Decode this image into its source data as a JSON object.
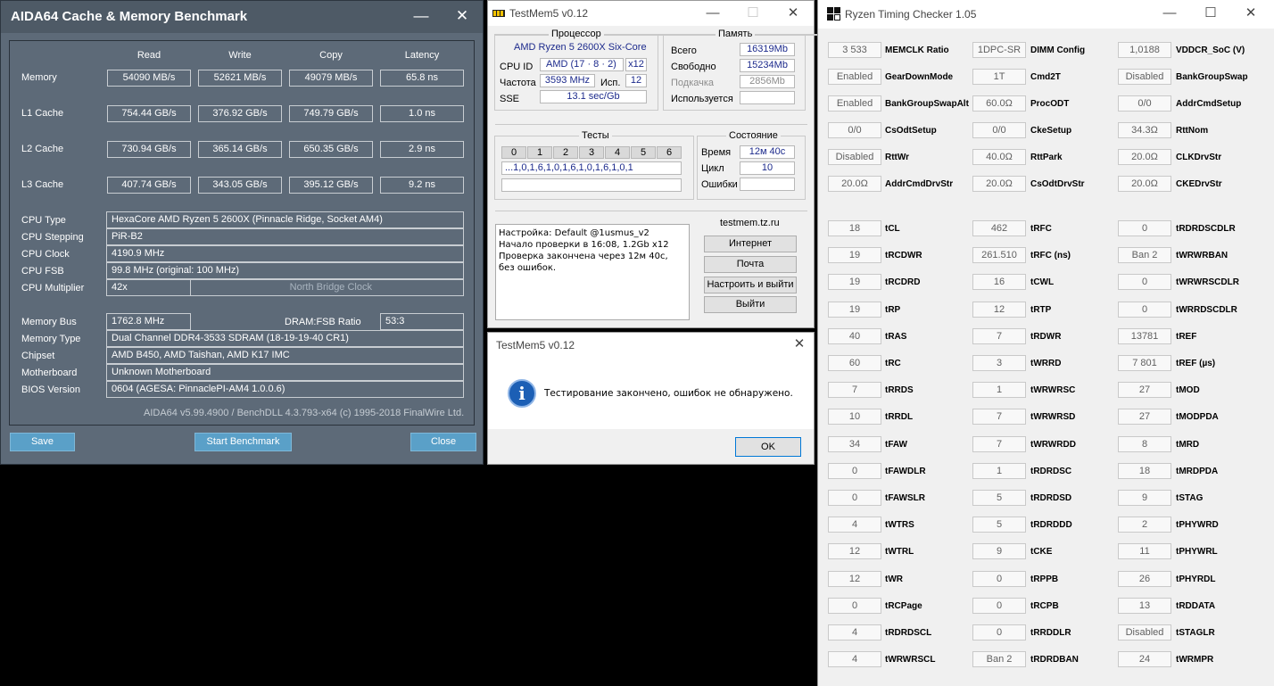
{
  "aida": {
    "title": "AIDA64 Cache & Memory Benchmark",
    "minimize": "—",
    "close_x": "✕",
    "columns": [
      "Read",
      "Write",
      "Copy",
      "Latency"
    ],
    "bench": [
      {
        "label": "Memory",
        "values": [
          "54090 MB/s",
          "52621 MB/s",
          "49079 MB/s",
          "65.8 ns"
        ]
      },
      {
        "label": "L1 Cache",
        "values": [
          "754.44 GB/s",
          "376.92 GB/s",
          "749.79 GB/s",
          "1.0 ns"
        ]
      },
      {
        "label": "L2 Cache",
        "values": [
          "730.94 GB/s",
          "365.14 GB/s",
          "650.35 GB/s",
          "2.9 ns"
        ]
      },
      {
        "label": "L3 Cache",
        "values": [
          "407.74 GB/s",
          "343.05 GB/s",
          "395.12 GB/s",
          "9.2 ns"
        ]
      }
    ],
    "cpu_type_label": "CPU Type",
    "cpu_type": "HexaCore AMD Ryzen 5 2600X  (Pinnacle Ridge, Socket AM4)",
    "cpu_stepping_label": "CPU Stepping",
    "cpu_stepping": "PiR-B2",
    "cpu_clock_label": "CPU Clock",
    "cpu_clock": "4190.9 MHz",
    "cpu_fsb_label": "CPU FSB",
    "cpu_fsb": "99.8 MHz  (original: 100 MHz)",
    "cpu_mult_label": "CPU Multiplier",
    "cpu_mult": "42x",
    "nb_clock_label": "North Bridge Clock",
    "mem_bus_label": "Memory Bus",
    "mem_bus": "1762.8 MHz",
    "dram_fsb_label": "DRAM:FSB Ratio",
    "dram_fsb": "53:3",
    "mem_type_label": "Memory Type",
    "mem_type": "Dual Channel DDR4-3533 SDRAM  (18-19-19-40 CR1)",
    "chipset_label": "Chipset",
    "chipset": "AMD B450, AMD Taishan, AMD K17 IMC",
    "mobo_label": "Motherboard",
    "mobo": "Unknown Motherboard",
    "bios_label": "BIOS Version",
    "bios": "0604  (AGESA: PinnaclePI-AM4 1.0.0.6)",
    "footer": "AIDA64 v5.99.4900 / BenchDLL 4.3.793-x64  (c) 1995-2018 FinalWire Ltd.",
    "btn_save": "Save",
    "btn_start": "Start Benchmark",
    "btn_close": "Close"
  },
  "testmem": {
    "title": "TestMem5 v0.12",
    "minimize": "—",
    "maximize": "☐",
    "close_x": "✕",
    "proc_group": "Процессор",
    "proc_name": "AMD Ryzen 5 2600X Six-Core",
    "cpu_id_label": "CPU ID",
    "cpu_id": "AMD  (17 · 8 · 2)",
    "cpu_threads": "x12",
    "freq_label": "Частота",
    "freq": "3593 MHz",
    "used_label": "Исп.",
    "used": "12",
    "sse_label": "SSE",
    "sse": "13.1 sec/Gb",
    "mem_group": "Память",
    "total_label": "Всего",
    "total": "16319Mb",
    "free_label": "Свободно",
    "free": "15234Mb",
    "swap_label": "Подкачка",
    "swap": "2856Mb",
    "inuse_label": "Используется",
    "tests_group": "Тесты",
    "test_headers": [
      "0",
      "1",
      "2",
      "3",
      "4",
      "5",
      "6"
    ],
    "test_seq": "...1,0,1,6,1,0,1,6,1,0,1,6,1,0,1",
    "state_group": "Состояние",
    "time_label": "Время",
    "time": "12м 40с",
    "cycle_label": "Цикл",
    "cycle": "10",
    "errors_label": "Ошибки",
    "log": "Настройка: Default @1usmus_v2\nНачало проверки в 16:08, 1.2Gb x12\nПроверка закончена через 12м 40с,\nбез ошибок.",
    "site": "testmem.tz.ru",
    "btn_internet": "Интернет",
    "btn_mail": "Почта",
    "btn_setup": "Настроить и выйти",
    "btn_exit": "Выйти"
  },
  "msgbox": {
    "title": "TestMem5 v0.12",
    "close_x": "✕",
    "icon": "info-icon",
    "text": "Тестирование закончено, ошибок не обнаружено.",
    "ok": "OK"
  },
  "rtc": {
    "title": "Ryzen Timing Checker 1.05",
    "minimize": "—",
    "maximize": "☐",
    "close_x": "✕",
    "top_rows": [
      [
        {
          "v": "3 533",
          "l": "MEMCLK Ratio"
        },
        {
          "v": "1DPC-SR",
          "l": "DIMM Config"
        },
        {
          "v": "1,0188",
          "l": "VDDCR_SoC (V)"
        }
      ],
      [
        {
          "v": "Enabled",
          "l": "GearDownMode"
        },
        {
          "v": "1T",
          "l": "Cmd2T"
        },
        {
          "v": "Disabled",
          "l": "BankGroupSwap"
        }
      ],
      [
        {
          "v": "Enabled",
          "l": "BankGroupSwapAlt"
        },
        {
          "v": "60.0Ω",
          "l": "ProcODT"
        },
        {
          "v": "0/0",
          "l": "AddrCmdSetup"
        }
      ],
      [
        {
          "v": "0/0",
          "l": "CsOdtSetup"
        },
        {
          "v": "0/0",
          "l": "CkeSetup"
        },
        {
          "v": "34.3Ω",
          "l": "RttNom"
        }
      ],
      [
        {
          "v": "Disabled",
          "l": "RttWr"
        },
        {
          "v": "40.0Ω",
          "l": "RttPark"
        },
        {
          "v": "20.0Ω",
          "l": "CLKDrvStr"
        }
      ],
      [
        {
          "v": "20.0Ω",
          "l": "AddrCmdDrvStr"
        },
        {
          "v": "20.0Ω",
          "l": "CsOdtDrvStr"
        },
        {
          "v": "20.0Ω",
          "l": "CKEDrvStr"
        }
      ]
    ],
    "timing_rows": [
      [
        {
          "v": "18",
          "l": "tCL"
        },
        {
          "v": "462",
          "l": "tRFC"
        },
        {
          "v": "0",
          "l": "tRDRDSCDLR"
        }
      ],
      [
        {
          "v": "19",
          "l": "tRCDWR"
        },
        {
          "v": "261.510",
          "l": "tRFC (ns)"
        },
        {
          "v": "Ban 2",
          "l": "tWRWRBAN"
        }
      ],
      [
        {
          "v": "19",
          "l": "tRCDRD"
        },
        {
          "v": "16",
          "l": "tCWL"
        },
        {
          "v": "0",
          "l": "tWRWRSCDLR"
        }
      ],
      [
        {
          "v": "19",
          "l": "tRP"
        },
        {
          "v": "12",
          "l": "tRTP"
        },
        {
          "v": "0",
          "l": "tWRRDSCDLR"
        }
      ],
      [
        {
          "v": "40",
          "l": "tRAS"
        },
        {
          "v": "7",
          "l": "tRDWR"
        },
        {
          "v": "13781",
          "l": "tREF"
        }
      ],
      [
        {
          "v": "60",
          "l": "tRC"
        },
        {
          "v": "3",
          "l": "tWRRD"
        },
        {
          "v": "7 801",
          "l": "tREF (µs)"
        }
      ],
      [
        {
          "v": "7",
          "l": "tRRDS"
        },
        {
          "v": "1",
          "l": "tWRWRSC"
        },
        {
          "v": "27",
          "l": "tMOD"
        }
      ],
      [
        {
          "v": "10",
          "l": "tRRDL"
        },
        {
          "v": "7",
          "l": "tWRWRSD"
        },
        {
          "v": "27",
          "l": "tMODPDA"
        }
      ],
      [
        {
          "v": "34",
          "l": "tFAW"
        },
        {
          "v": "7",
          "l": "tWRWRDD"
        },
        {
          "v": "8",
          "l": "tMRD"
        }
      ],
      [
        {
          "v": "0",
          "l": "tFAWDLR"
        },
        {
          "v": "1",
          "l": "tRDRDSC"
        },
        {
          "v": "18",
          "l": "tMRDPDA"
        }
      ],
      [
        {
          "v": "0",
          "l": "tFAWSLR"
        },
        {
          "v": "5",
          "l": "tRDRDSD"
        },
        {
          "v": "9",
          "l": "tSTAG"
        }
      ],
      [
        {
          "v": "4",
          "l": "tWTRS"
        },
        {
          "v": "5",
          "l": "tRDRDDD"
        },
        {
          "v": "2",
          "l": "tPHYWRD"
        }
      ],
      [
        {
          "v": "12",
          "l": "tWTRL"
        },
        {
          "v": "9",
          "l": "tCKE"
        },
        {
          "v": "11",
          "l": "tPHYWRL"
        }
      ],
      [
        {
          "v": "12",
          "l": "tWR"
        },
        {
          "v": "0",
          "l": "tRPPB"
        },
        {
          "v": "26",
          "l": "tPHYRDL"
        }
      ],
      [
        {
          "v": "0",
          "l": "tRCPage"
        },
        {
          "v": "0",
          "l": "tRCPB"
        },
        {
          "v": "13",
          "l": "tRDDATA"
        }
      ],
      [
        {
          "v": "4",
          "l": "tRDRDSCL"
        },
        {
          "v": "0",
          "l": "tRRDDLR"
        },
        {
          "v": "Disabled",
          "l": "tSTAGLR"
        }
      ],
      [
        {
          "v": "4",
          "l": "tWRWRSCL"
        },
        {
          "v": "Ban 2",
          "l": "tRDRDBAN"
        },
        {
          "v": "24",
          "l": "tWRMPR"
        }
      ]
    ]
  }
}
